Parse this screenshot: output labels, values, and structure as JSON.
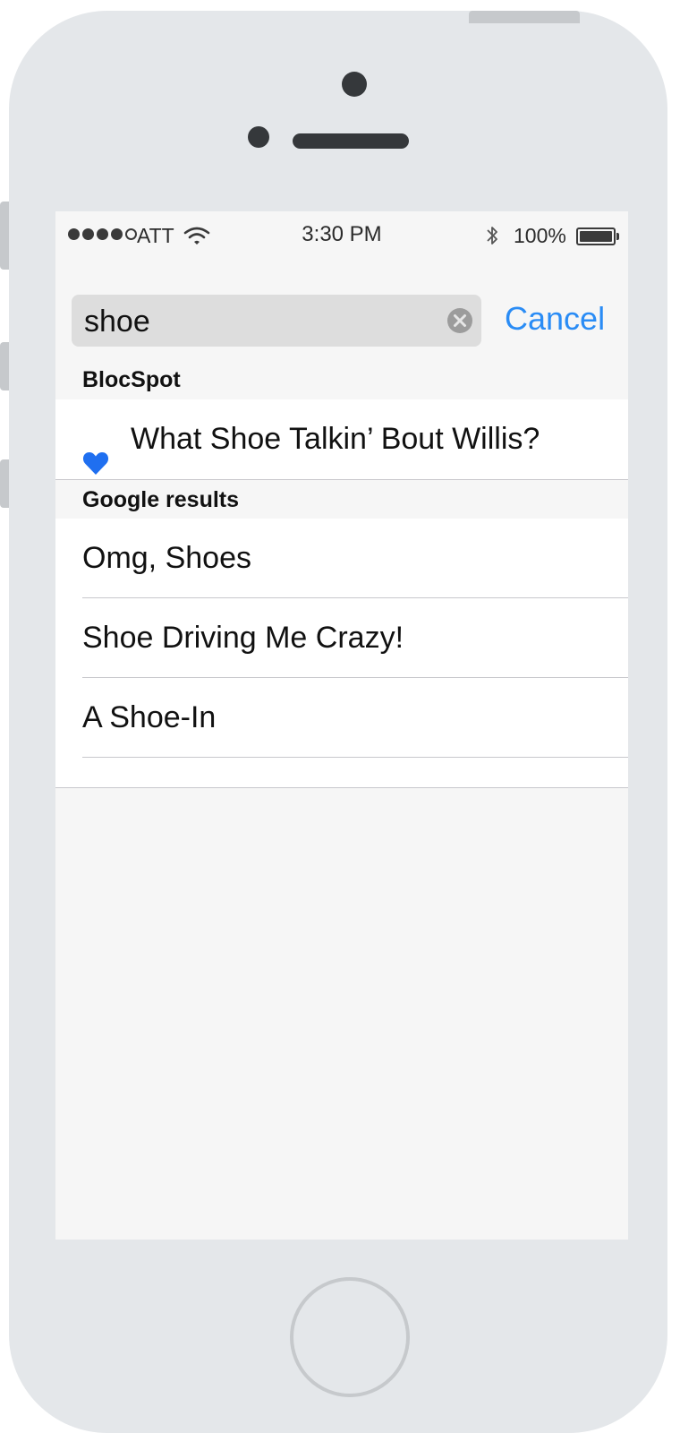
{
  "status_bar": {
    "carrier": "ATT",
    "time": "3:30 PM",
    "battery_percent": "100%",
    "signal_bars_filled": 4,
    "signal_bars_total": 5,
    "icons": [
      "wifi-icon",
      "bluetooth-icon",
      "battery-icon"
    ]
  },
  "search": {
    "value": "shoe",
    "clear_icon": "clear-icon",
    "cancel_label": "Cancel"
  },
  "sections": [
    {
      "header": "BlocSpot",
      "items": [
        {
          "label": "What Shoe Talkin’ Bout Willis?",
          "icon": "heart-icon"
        }
      ]
    },
    {
      "header": "Google results",
      "items": [
        {
          "label": "Omg, Shoes"
        },
        {
          "label": "Shoe Driving Me Crazy!"
        },
        {
          "label": "A Shoe-In"
        }
      ]
    }
  ],
  "colors": {
    "accent": "#2a8cf5",
    "heart": "#1f6ff0",
    "phone_body": "#e4e7ea",
    "screen_bg": "#f6f6f6",
    "search_field_bg": "#dddddd"
  }
}
